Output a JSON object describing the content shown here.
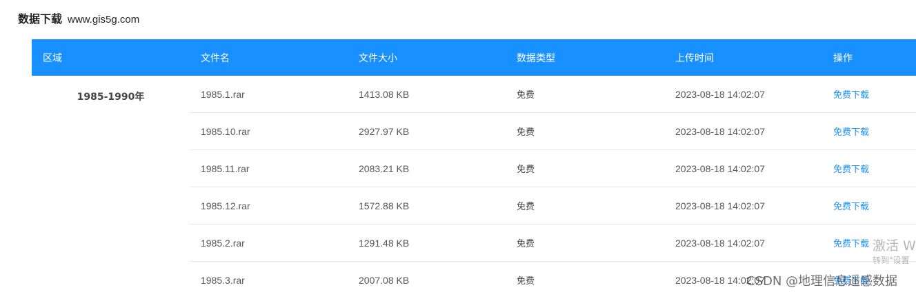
{
  "header": {
    "title": "数据下载",
    "site": "www.gis5g.com"
  },
  "table": {
    "columns": [
      "区域",
      "文件名",
      "文件大小",
      "数据类型",
      "上传时间",
      "操作"
    ],
    "region": "1985-1990年",
    "rows": [
      {
        "file": "1985.1.rar",
        "size": "1413.08 KB",
        "type": "免费",
        "time": "2023-08-18 14:02:07",
        "action": "免费下载"
      },
      {
        "file": "1985.10.rar",
        "size": "2927.97 KB",
        "type": "免费",
        "time": "2023-08-18 14:02:07",
        "action": "免费下载"
      },
      {
        "file": "1985.11.rar",
        "size": "2083.21 KB",
        "type": "免费",
        "time": "2023-08-18 14:02:07",
        "action": "免费下载"
      },
      {
        "file": "1985.12.rar",
        "size": "1572.88 KB",
        "type": "免费",
        "time": "2023-08-18 14:02:07",
        "action": "免费下载"
      },
      {
        "file": "1985.2.rar",
        "size": "1291.48 KB",
        "type": "免费",
        "time": "2023-08-18 14:02:07",
        "action": "免费下载"
      },
      {
        "file": "1985.3.rar",
        "size": "2007.08 KB",
        "type": "免费",
        "time": "2023-08-18 14:02:07",
        "action": "免费下载"
      }
    ]
  },
  "overlay": {
    "activate_windows": "激活 W",
    "goto_settings": "转到\"设置",
    "csdn_credit": "CSDN @地理信息遥感数据"
  },
  "colors": {
    "header_bg": "#1890ff",
    "link": "#1890ff"
  }
}
